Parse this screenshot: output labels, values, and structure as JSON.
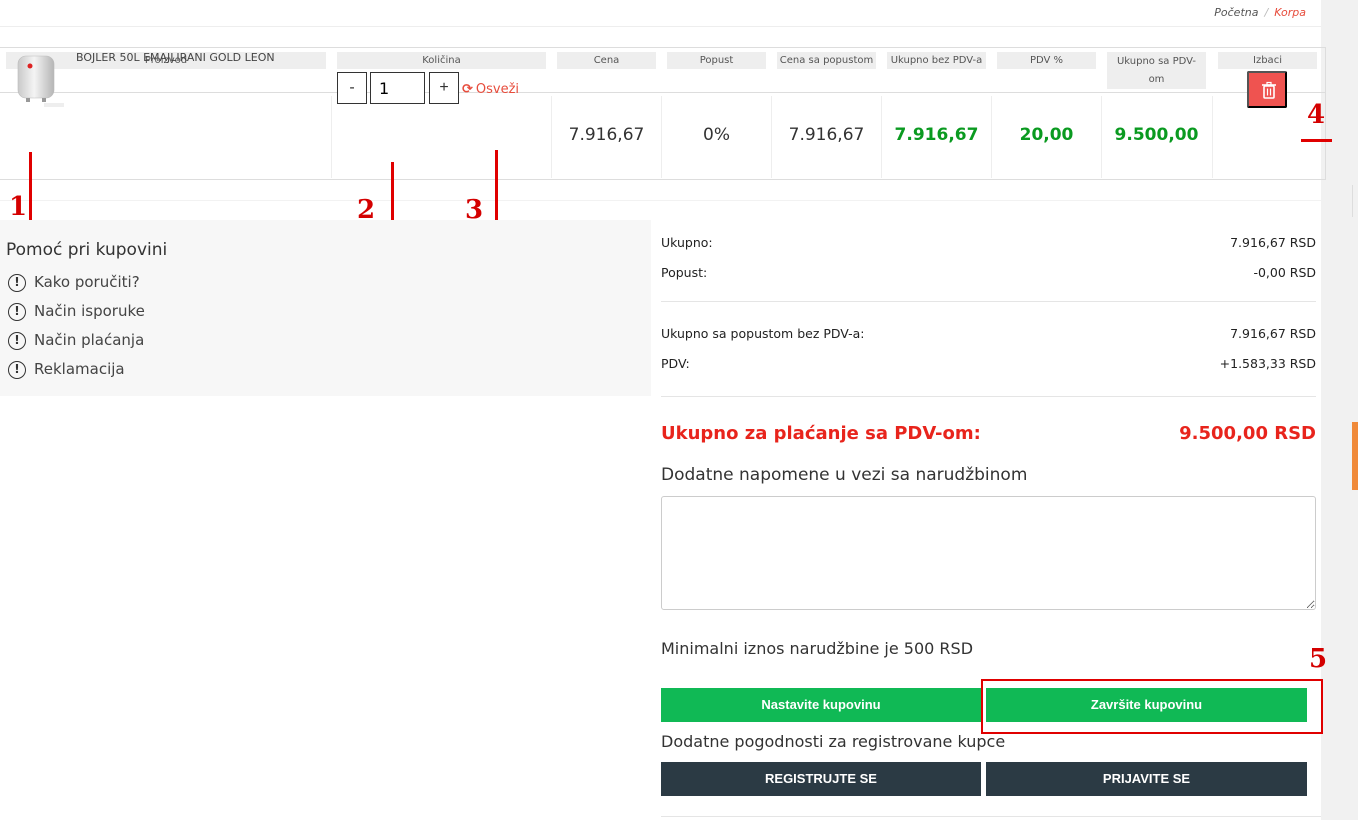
{
  "breadcrumb": {
    "home": "Početna",
    "separator": "/",
    "current": "Korpa"
  },
  "table": {
    "headers": {
      "product": "Proizvod",
      "quantity": "Količina",
      "price": "Cena",
      "discount": "Popust",
      "discounted_price": "Cena sa popustom",
      "total_no_vat": "Ukupno bez PDV-a",
      "vat_percent": "PDV %",
      "total_with_vat_line1": "Ukupno sa PDV-",
      "total_with_vat_line2": "om",
      "remove": "Izbaci"
    },
    "row": {
      "product_name": "BOJLER 50L EMAJLIRANI GOLD LEON",
      "minus": "-",
      "quantity": "1",
      "plus": "+",
      "refresh": "Osveži",
      "price": "7.916,67",
      "discount": "0%",
      "discounted_price": "7.916,67",
      "total_no_vat": "7.916,67",
      "vat_percent": "20,00",
      "total_with_vat": "9.500,00"
    }
  },
  "annotations": [
    "1",
    "2",
    "3",
    "4",
    "5"
  ],
  "help": {
    "title": "Pomoć pri kupovini",
    "items": [
      "Kako poručiti?",
      "Način isporuke",
      "Način plaćanja",
      "Reklamacija"
    ]
  },
  "summary": {
    "total_label": "Ukupno:",
    "total_value": "7.916,67 RSD",
    "discount_label": "Popust:",
    "discount_value": "-0,00 RSD",
    "discounted_no_vat_label": "Ukupno sa popustom bez PDV-a:",
    "discounted_no_vat_value": "7.916,67 RSD",
    "vat_label": "PDV:",
    "vat_value": "+1.583,33 RSD",
    "grand_total_label": "Ukupno za plaćanje sa PDV-om:",
    "grand_total_value": "9.500,00 RSD"
  },
  "notes_label": "Dodatne napomene u vezi sa narudžbinom",
  "min_order": "Minimalni iznos narudžbine je 500 RSD",
  "buttons": {
    "continue": "Nastavite kupovinu",
    "finish": "Završite kupovinu",
    "register": "REGISTRUJTE SE",
    "login": "PRIJAVITE SE"
  },
  "registered_label": "Dodatne pogodnosti za registrovane kupce",
  "colors": {
    "accent_red": "#e74c3c",
    "total_red": "#e8241c",
    "value_green": "#0a9a20",
    "button_green": "#10b955",
    "button_dark": "#2b3a44",
    "delete_red": "#ef5350"
  }
}
